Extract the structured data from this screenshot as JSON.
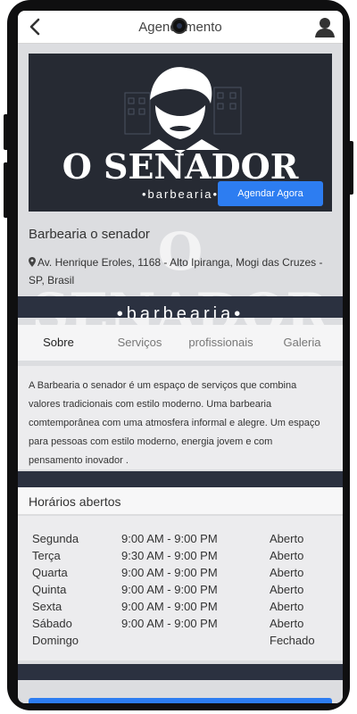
{
  "header": {
    "title": "Agendamento",
    "back_icon": "back-arrow-icon",
    "profile_icon": "user-avatar-icon"
  },
  "banner": {
    "brand_name": "O SENADOR",
    "brand_tagline": "•barbearia•",
    "cta_label": "Agendar Agora"
  },
  "shop": {
    "name": "Barbearia o senador",
    "address": "Av. Henrique Eroles, 1168 - Alto Ipiranga, Mogi das Cruzes - SP, Brasil",
    "address_icon": "location-pin-icon"
  },
  "strip": {
    "text": "•barbearia•"
  },
  "tabs": [
    {
      "label": "Sobre",
      "active": true
    },
    {
      "label": "Serviços"
    },
    {
      "label": "profissionais"
    },
    {
      "label": "Galeria"
    }
  ],
  "about": {
    "text": "A Barbearia o senador é um espaço de serviços que combina valores tradicionais com estilo moderno. Uma barbearia comtemporânea com uma atmosfera informal e alegre. Um espaço para pessoas com estilo moderno, energia jovem e com pensamento inovador ."
  },
  "hours": {
    "title": "Horários abertos",
    "rows": [
      {
        "day": "Segunda",
        "time": "9:00 AM - 9:00 PM",
        "status": "Aberto"
      },
      {
        "day": "Terça",
        "time": "9:30 AM - 9:00 PM",
        "status": "Aberto"
      },
      {
        "day": "Quarta",
        "time": "9:00 AM - 9:00 PM",
        "status": "Aberto"
      },
      {
        "day": "Quinta",
        "time": "9:00 AM - 9:00 PM",
        "status": "Aberto"
      },
      {
        "day": "Sexta",
        "time": "9:00 AM - 9:00 PM",
        "status": "Aberto"
      },
      {
        "day": "Sábado",
        "time": "9:00 AM - 9:00 PM",
        "status": "Aberto"
      },
      {
        "day": "Domingo",
        "time": "",
        "status": "Fechado"
      }
    ]
  },
  "colors": {
    "accent": "#2d7df1",
    "dark": "#2b3140"
  }
}
